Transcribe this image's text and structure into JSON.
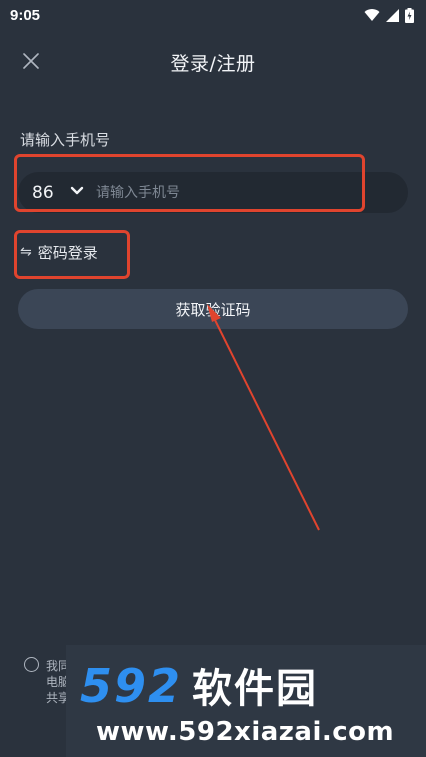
{
  "status_bar": {
    "time": "9:05",
    "icons": [
      "wifi-icon",
      "signal-icon",
      "battery-charging-icon"
    ]
  },
  "header": {
    "close_icon": "close-icon",
    "title": "登录/注册"
  },
  "form": {
    "phone_label": "请输入手机号",
    "country_code": "86",
    "country_chevron_icon": "chevron-down-icon",
    "phone_placeholder": "请输入手机号",
    "phone_value": "",
    "password_login_icon": "swap-arrows-icon",
    "password_login_label": "密码登录",
    "get_code_button": "获取验证码"
  },
  "agreement": {
    "line1": "我同",
    "line2": "电脑",
    "line3": "共享",
    "checked": false
  },
  "watermark": {
    "number": "592",
    "name": "软件园",
    "url": "www.592xiazai.com"
  },
  "colors": {
    "background": "#2a323d",
    "input_background": "#222932",
    "button_background": "#3b4656",
    "annotation_red": "#e0442e",
    "watermark_blue": "#2e8ff0"
  }
}
